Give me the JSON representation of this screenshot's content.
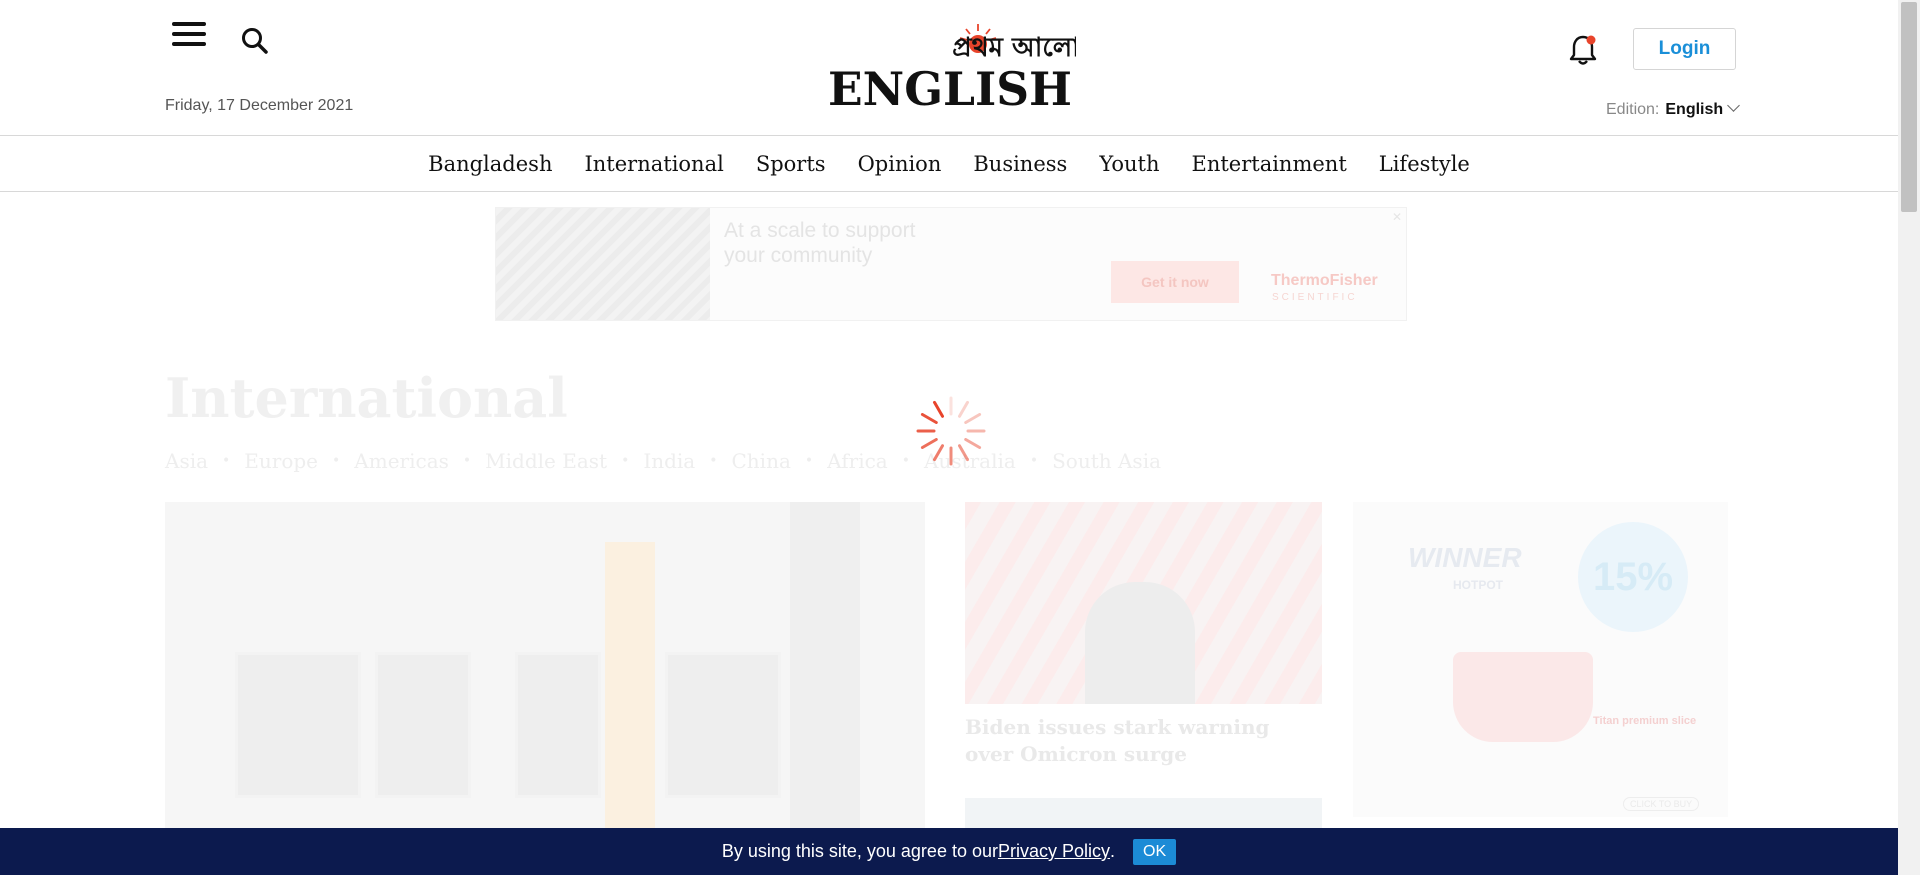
{
  "header": {
    "date": "Friday, 17 December 2021",
    "logo_bangla": "প্রথম আলো",
    "logo_english": "ENGLISH",
    "login_label": "Login",
    "edition_label": "Edition:",
    "edition_value": "English"
  },
  "nav": {
    "items": [
      "Bangladesh",
      "International",
      "Sports",
      "Opinion",
      "Business",
      "Youth",
      "Entertainment",
      "Lifestyle"
    ]
  },
  "ad_banner": {
    "headline": "At a scale to support your community",
    "cta": "Get it now",
    "brand": "ThermoFisher",
    "brand_sub": "SCIENTIFIC"
  },
  "section": {
    "title": "International",
    "subnav": [
      "Asia",
      "Europe",
      "Americas",
      "Middle East",
      "India",
      "China",
      "Africa",
      "Australia",
      "South Asia"
    ]
  },
  "stories": {
    "story1_title": "Biden issues stark warning over Omicron surge"
  },
  "side_ad": {
    "brand": "WINNER",
    "sub": "HOTPOT",
    "badge": "15%",
    "tag": "Titan premium slice",
    "cta": "CLICK TO BUY"
  },
  "cookie": {
    "text": "By using this site, you agree to our ",
    "link": "Privacy Policy",
    "suffix": ".",
    "ok": "OK"
  },
  "colors": {
    "accent_blue": "#1a8fd8",
    "cookie_bg": "#0c1a4e",
    "logo_red": "#e8442b",
    "spinner": "#e8442b"
  }
}
